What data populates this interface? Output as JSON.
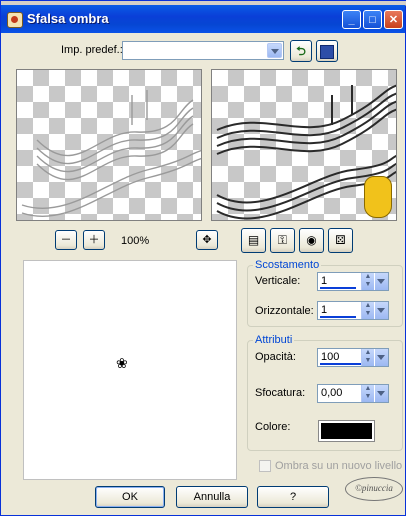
{
  "window": {
    "title": "Sfalsa ombra"
  },
  "preset": {
    "label": "Imp. predef.:",
    "value": ""
  },
  "zoom": {
    "level": "100%"
  },
  "offset": {
    "group_title": "Scostamento",
    "vertical_label": "Verticale:",
    "vertical_value": "1",
    "horizontal_label": "Orizzontale:",
    "horizontal_value": "1"
  },
  "attributes": {
    "group_title": "Attributi",
    "opacity_label": "Opacità:",
    "opacity_value": "100",
    "blur_label": "Sfocatura:",
    "blur_value": "0,00",
    "color_label": "Colore:",
    "color": "#000000"
  },
  "new_layer": {
    "label": "Ombra su un nuovo livello",
    "checked": false
  },
  "buttons": {
    "ok": "OK",
    "cancel": "Annulla",
    "help": "?"
  },
  "watermark": "©pinuccia"
}
